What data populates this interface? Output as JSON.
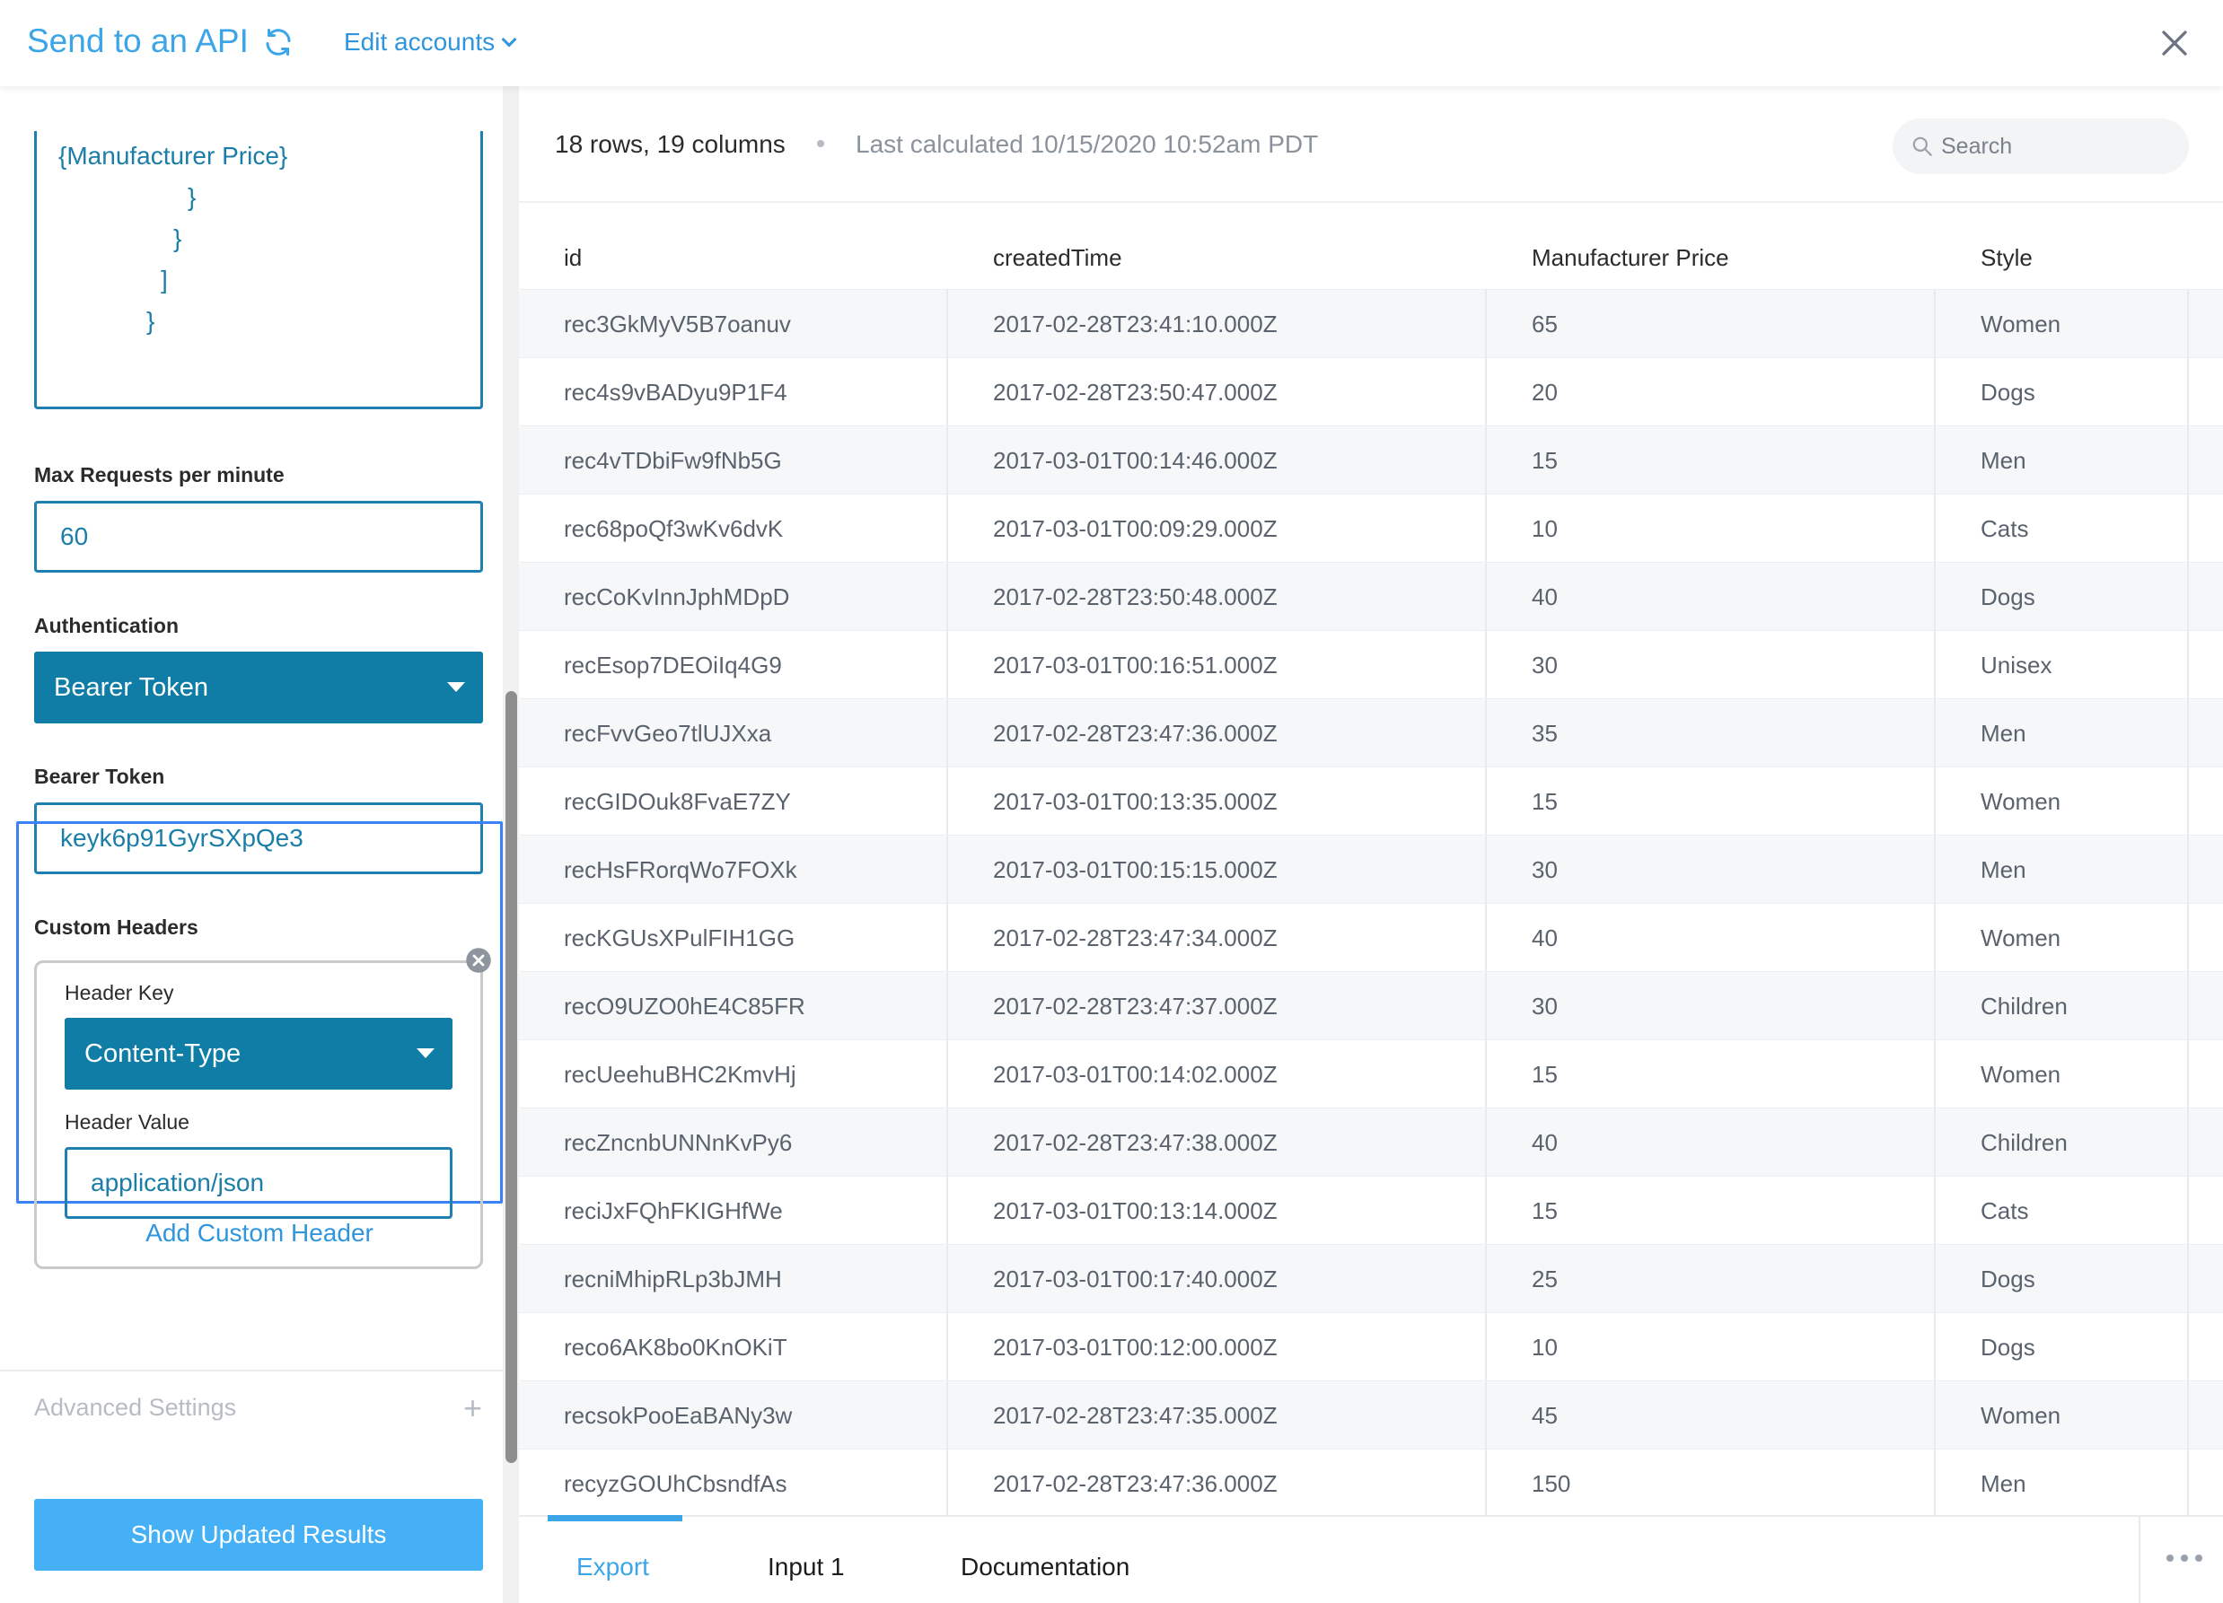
{
  "header": {
    "title": "Send to an API",
    "edit_accounts_label": "Edit accounts"
  },
  "left_panel": {
    "body_lines": [
      "{Manufacturer Price}",
      "}",
      "}",
      "]",
      "}"
    ],
    "max_requests": {
      "label": "Max Requests per minute",
      "value": "60"
    },
    "authentication": {
      "label": "Authentication",
      "selected": "Bearer Token"
    },
    "bearer_token": {
      "label": "Bearer Token",
      "value": "keyk6p91GyrSXpQe3"
    },
    "custom_headers": {
      "label": "Custom Headers",
      "header_key_label": "Header Key",
      "header_key_selected": "Content-Type",
      "header_value_label": "Header Value",
      "header_value": "application/json"
    },
    "add_custom_header_label": "Add Custom Header",
    "advanced_settings_label": "Advanced Settings",
    "show_updated_results_label": "Show Updated Results"
  },
  "right_panel": {
    "summary": "18 rows, 19 columns",
    "last_calculated": "Last calculated 10/15/2020 10:52am PDT",
    "search_placeholder": "Search",
    "columns": [
      "id",
      "createdTime",
      "Manufacturer Price",
      "Style"
    ],
    "rows": [
      [
        "rec3GkMyV5B7oanuv",
        "2017-02-28T23:41:10.000Z",
        "65",
        "Women"
      ],
      [
        "rec4s9vBADyu9P1F4",
        "2017-02-28T23:50:47.000Z",
        "20",
        "Dogs"
      ],
      [
        "rec4vTDbiFw9fNb5G",
        "2017-03-01T00:14:46.000Z",
        "15",
        "Men"
      ],
      [
        "rec68poQf3wKv6dvK",
        "2017-03-01T00:09:29.000Z",
        "10",
        "Cats"
      ],
      [
        "recCoKvInnJphMDpD",
        "2017-02-28T23:50:48.000Z",
        "40",
        "Dogs"
      ],
      [
        "recEsop7DEOiIq4G9",
        "2017-03-01T00:16:51.000Z",
        "30",
        "Unisex"
      ],
      [
        "recFvvGeo7tlUJXxa",
        "2017-02-28T23:47:36.000Z",
        "35",
        "Men"
      ],
      [
        "recGIDOuk8FvaE7ZY",
        "2017-03-01T00:13:35.000Z",
        "15",
        "Women"
      ],
      [
        "recHsFRorqWo7FOXk",
        "2017-03-01T00:15:15.000Z",
        "30",
        "Men"
      ],
      [
        "recKGUsXPulFIH1GG",
        "2017-02-28T23:47:34.000Z",
        "40",
        "Women"
      ],
      [
        "recO9UZO0hE4C85FR",
        "2017-02-28T23:47:37.000Z",
        "30",
        "Children"
      ],
      [
        "recUeehuBHC2KmvHj",
        "2017-03-01T00:14:02.000Z",
        "15",
        "Women"
      ],
      [
        "recZncnbUNNnKvPy6",
        "2017-02-28T23:47:38.000Z",
        "40",
        "Children"
      ],
      [
        "reciJxFQhFKIGHfWe",
        "2017-03-01T00:13:14.000Z",
        "15",
        "Cats"
      ],
      [
        "recniMhipRLp3bJMH",
        "2017-03-01T00:17:40.000Z",
        "25",
        "Dogs"
      ],
      [
        "reco6AK8bo0KnOKiT",
        "2017-03-01T00:12:00.000Z",
        "10",
        "Dogs"
      ],
      [
        "recsokPooEaBANy3w",
        "2017-02-28T23:47:35.000Z",
        "45",
        "Women"
      ],
      [
        "recyzGOUhCbsndfAs",
        "2017-02-28T23:47:36.000Z",
        "150",
        "Men"
      ]
    ]
  },
  "tabs": [
    {
      "label": "Export",
      "active": true
    },
    {
      "label": "Input 1",
      "active": false
    },
    {
      "label": "Documentation",
      "active": false
    }
  ],
  "colors": {
    "accent": "#3ba5e8",
    "select_bg": "#0f7da6",
    "input_border": "#1f7fb0",
    "focus_border": "#3b82f6",
    "primary_button": "#45b0f5"
  },
  "icons": [
    "refresh-icon",
    "chevron-down-icon",
    "close-icon",
    "remove-icon",
    "plus-icon",
    "search-icon",
    "more-icon"
  ]
}
